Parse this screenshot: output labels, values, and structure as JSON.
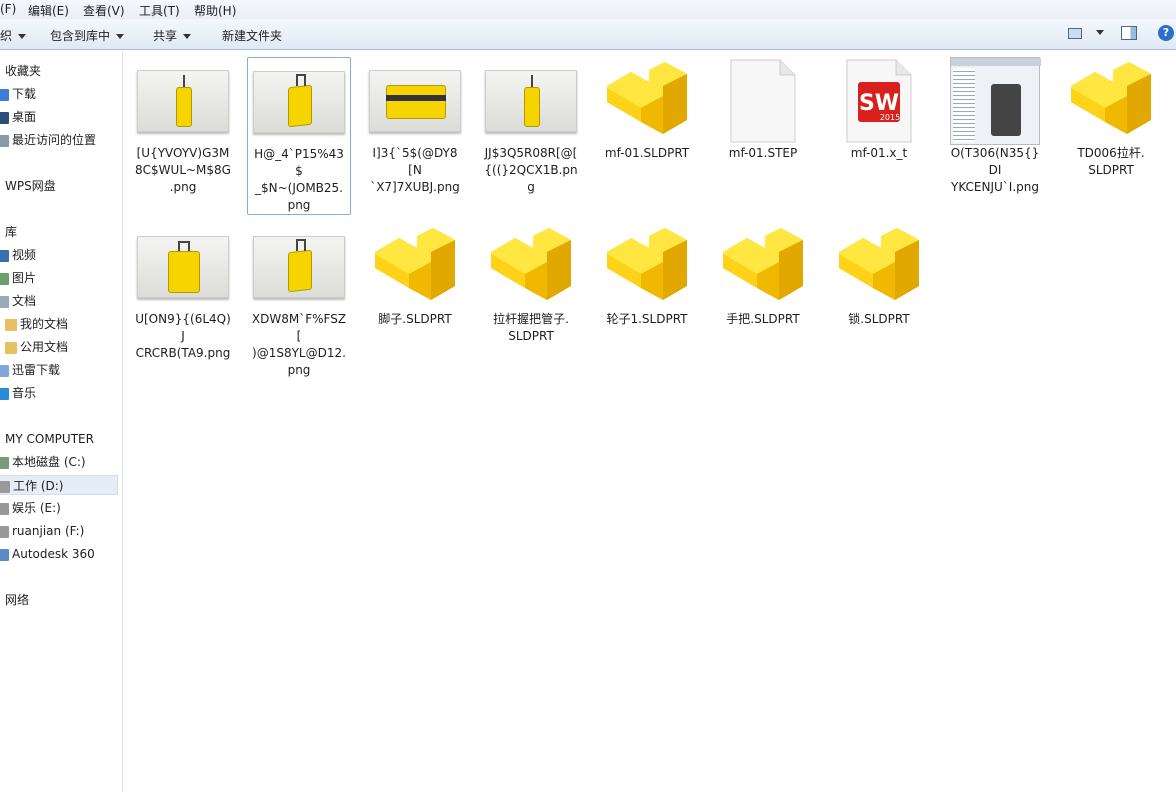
{
  "menu": [
    "(F)",
    "编辑(E)",
    "查看(V)",
    "工具(T)",
    "帮助(H)"
  ],
  "toolbar": {
    "organize": "织",
    "include": "包含到库中",
    "share": "共享",
    "new_folder": "新建文件夹"
  },
  "sidebar": [
    {
      "label": "收藏夹",
      "type": "header"
    },
    {
      "label": "下载",
      "icon": "download-icon",
      "color": "#3b7dd8"
    },
    {
      "label": "桌面",
      "icon": "desktop-icon",
      "color": "#2a4d7a"
    },
    {
      "label": "最近访问的位置",
      "icon": "recent-places-icon",
      "color": "#8899aa"
    },
    {
      "label": "WPS网盘",
      "type": "header"
    },
    {
      "label": "库",
      "type": "header"
    },
    {
      "label": "视频",
      "icon": "video-icon",
      "color": "#3a6fb0"
    },
    {
      "label": "图片",
      "icon": "pictures-icon",
      "color": "#6aa06a"
    },
    {
      "label": "文档",
      "icon": "documents-icon",
      "color": "#9ab"
    },
    {
      "label": "我的文档",
      "icon": "folder-icon",
      "color": "#e8c060",
      "indent": true
    },
    {
      "label": "公用文档",
      "icon": "folder-icon",
      "color": "#e8c060",
      "indent": true
    },
    {
      "label": "迅雷下载",
      "icon": "thunder-download-icon",
      "color": "#7fa8d8"
    },
    {
      "label": "音乐",
      "icon": "music-icon",
      "color": "#2a8ad8"
    },
    {
      "label": "MY COMPUTER",
      "type": "header"
    },
    {
      "label": "本地磁盘 (C:)",
      "icon": "drive-icon",
      "color": "#7a9a7a"
    },
    {
      "label": "工作 (D:)",
      "icon": "drive-icon",
      "color": "#999",
      "selected": true
    },
    {
      "label": "娱乐 (E:)",
      "icon": "drive-icon",
      "color": "#999"
    },
    {
      "label": "ruanjian (F:)",
      "icon": "drive-icon",
      "color": "#999"
    },
    {
      "label": "Autodesk 360",
      "icon": "autodesk-360-icon",
      "color": "#5a8ac8"
    },
    {
      "label": "网络",
      "type": "header"
    }
  ],
  "files": [
    {
      "name": "[U{YVOYV)G3M8C$WUL~M$8G.png",
      "lines": [
        "[U{YVOYV)G3M",
        "8C$WUL~M$8G",
        ".png"
      ],
      "kind": "photo",
      "v": "upright"
    },
    {
      "name": "H@_4`P15%43$_$N~(JOMB25.png",
      "lines": [
        "H@_4`P15%43$",
        "_$N~(JOMB25.",
        "png"
      ],
      "kind": "photo",
      "v": "angle",
      "selected": true
    },
    {
      "name": "I]3{`5$(@DY8[N`X7]7XUBJ.png",
      "lines": [
        "I]3{`5$(@DY8[N",
        "`X7]7XUBJ.png"
      ],
      "kind": "photo",
      "v": "flat"
    },
    {
      "name": "JJ$3Q5R08R[@[{((}2QCX1B.png",
      "lines": [
        "JJ$3Q5R08R[@[",
        "{((}2QCX1B.png"
      ],
      "kind": "photo",
      "v": "side"
    },
    {
      "name": "mf-01.SLDPRT",
      "lines": [
        "mf-01.SLDPRT"
      ],
      "kind": "part"
    },
    {
      "name": "mf-01.STEP",
      "lines": [
        "mf-01.STEP"
      ],
      "kind": "blank"
    },
    {
      "name": "mf-01.x_t",
      "lines": [
        "mf-01.x_t"
      ],
      "kind": "sw",
      "badge": "2015"
    },
    {
      "name": "O(T306(N35{}DIYKCENJU`I.png",
      "lines": [
        "O(T306(N35{}DI",
        "YKCENJU`I.png"
      ],
      "kind": "screen"
    },
    {
      "name": "TD006拉杆.SLDPRT",
      "lines": [
        "TD006拉杆.",
        "SLDPRT"
      ],
      "kind": "part"
    },
    {
      "name": "U[ON9}{(6L4Q)JCRCRB(TA9.png",
      "lines": [
        "U[ON9}{(6L4Q)J",
        "CRCRB(TA9.png"
      ],
      "kind": "photo",
      "v": "front"
    },
    {
      "name": "XDW8M`F%FSZ[)@1S8YL@D12.png",
      "lines": [
        "XDW8M`F%FSZ[",
        ")@1S8YL@D12.",
        "png"
      ],
      "kind": "photo",
      "v": "angle"
    },
    {
      "name": "脚子.SLDPRT",
      "lines": [
        "脚子.SLDPRT"
      ],
      "kind": "part"
    },
    {
      "name": "拉杆握把管子.SLDPRT",
      "lines": [
        "拉杆握把管子.",
        "SLDPRT"
      ],
      "kind": "part"
    },
    {
      "name": "轮子1.SLDPRT",
      "lines": [
        "轮子1.SLDPRT"
      ],
      "kind": "part"
    },
    {
      "name": "手把.SLDPRT",
      "lines": [
        "手把.SLDPRT"
      ],
      "kind": "part"
    },
    {
      "name": "锁.SLDPRT",
      "lines": [
        "锁.SLDPRT"
      ],
      "kind": "part"
    }
  ]
}
